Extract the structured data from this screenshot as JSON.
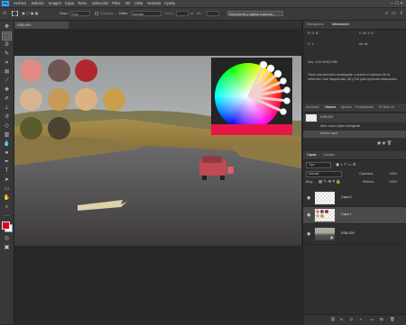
{
  "menubar": {
    "logo": "Ps",
    "items": [
      "Archivo",
      "Edición",
      "Imagen",
      "Capa",
      "Texto",
      "Selección",
      "Filtro",
      "3D",
      "Vista",
      "Ventana",
      "Ayuda"
    ]
  },
  "options": {
    "desv_label": "Desv.:",
    "desv_value": "0 px",
    "suavizar_label": "Suavizar",
    "estilo_label": "Estilo:",
    "estilo_value": "Normal",
    "anchura_label": "Anch.:",
    "altura_label": "Alt.:",
    "select_button": "Seleccionar y aplicar máscara..."
  },
  "document": {
    "tab_label": "DSB-000",
    "swatch_colors": [
      "#e08a85",
      "#6f5652",
      "#b0282e",
      "#d8b591",
      "#c89a5a",
      "#ddb283",
      "#c9a048",
      "#5c5b2c",
      "#4b4330"
    ]
  },
  "panels": {
    "top_tabs": [
      "Histograma",
      "Información"
    ],
    "info_lines": [
      "Doc: 4,00 M/46,0 MB",
      "Traza una selección rectangular o mueve el contorno de la selección. Use Mayúsculas, Alt y Ctrl para opciones adicionales."
    ],
    "history_tabs": [
      "Acciones",
      "Historia",
      "Ajustes",
      "Propiedades",
      "TE Beat 10"
    ],
    "history_items": [
      "DSB-000",
      "Abrir como objeto inteligente",
      "Nueva capa"
    ],
    "layers_tabs": [
      "Capas",
      "Canales"
    ],
    "layers_kind": "Tipo",
    "blend_mode": "Normal",
    "opacity_label": "Opacidad:",
    "opacity_value": "100%",
    "lock_label": "Bloq.:",
    "fill_label": "Relleno:",
    "fill_value": "100%",
    "layers": [
      {
        "name": "Capa 2"
      },
      {
        "name": "Capa 1"
      },
      {
        "name": "DSB-000"
      }
    ],
    "footer_icons": [
      "link-icon",
      "fx-icon",
      "mask-icon",
      "adjustment-icon",
      "group-icon",
      "new-layer-icon",
      "trash-icon"
    ]
  },
  "colors": {
    "foreground": "#e3001b",
    "background": "#ffffff",
    "accent": "#31a8ff"
  }
}
